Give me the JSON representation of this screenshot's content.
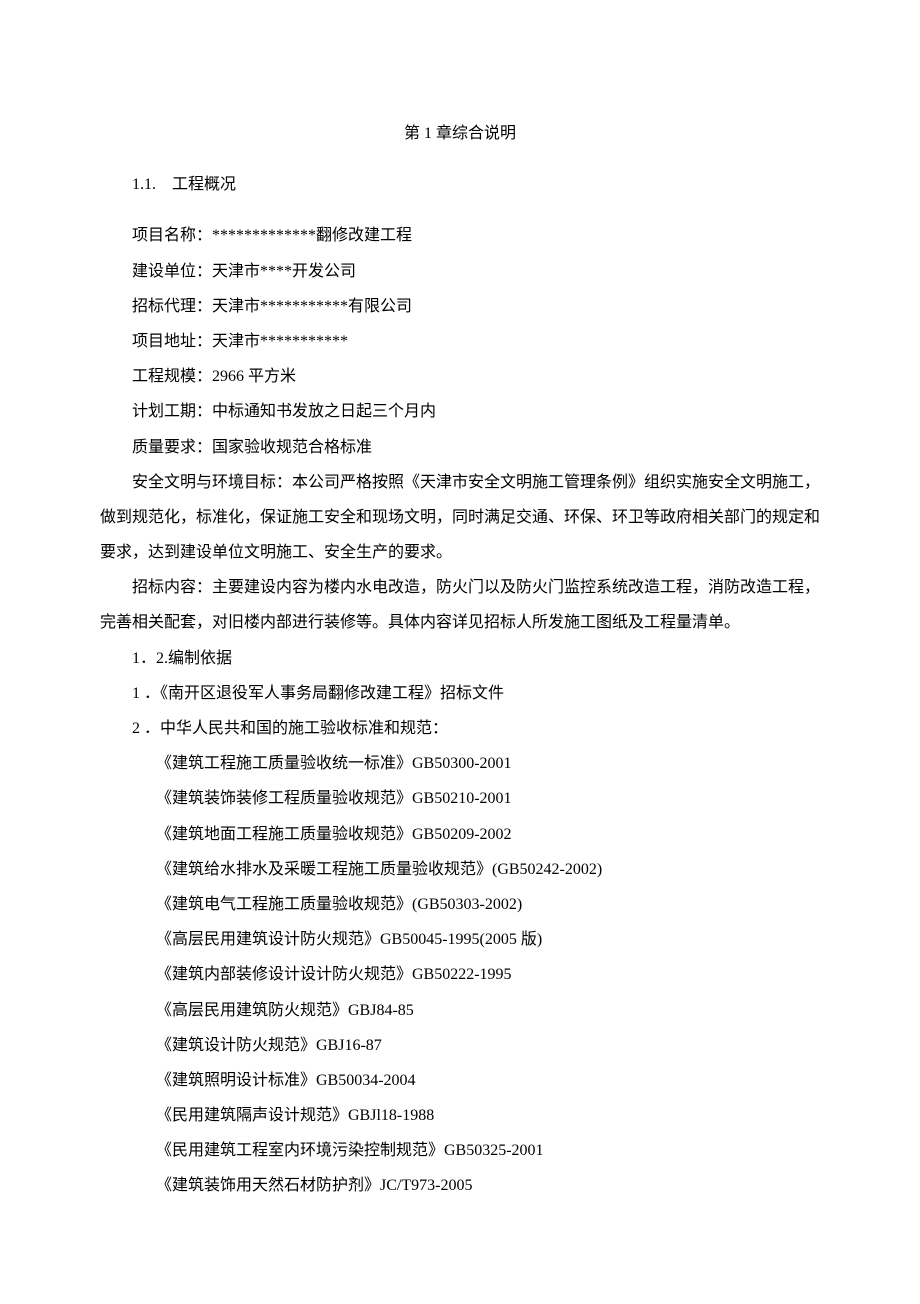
{
  "title": "第 1 章综合说明",
  "s1": {
    "heading": "1.1.　工程概况",
    "project_name": "项目名称：*************翻修改建工程",
    "construction_unit": "建设单位：天津市****开发公司",
    "bidding_agent": "招标代理：天津市***********有限公司",
    "project_address": "项目地址：天津市***********",
    "project_scale": "工程规模：2966 平方米",
    "planned_duration": "计划工期：中标通知书发放之日起三个月内",
    "quality_requirement": "质量要求：国家验收规范合格标准",
    "safety_para": "安全文明与环境目标：本公司严格按照《天津市安全文明施工管理条例》组织实施安全文明施工，做到规范化，标准化，保证施工安全和现场文明，同时满足交通、环保、环卫等政府相关部门的规定和要求，达到建设单位文明施工、安全生产的要求。",
    "bid_content": "招标内容：主要建设内容为楼内水电改造，防火门以及防火门监控系统改造工程，消防改造工程，完善相关配套，对旧楼内部进行装修等。具体内容详见招标人所发施工图纸及工程量清单。"
  },
  "s2": {
    "heading": "1．2.编制依据",
    "item1": "1 ．《南开区退役军人事务局翻修改建工程》招标文件",
    "item2": "2 ．中华人民共和国的施工验收标准和规范：",
    "standards": [
      "《建筑工程施工质量验收统一标准》GB50300-2001",
      "《建筑装饰装修工程质量验收规范》GB50210-2001",
      "《建筑地面工程施工质量验收规范》GB50209-2002",
      "《建筑给水排水及采暖工程施工质量验收规范》(GB50242-2002)",
      "《建筑电气工程施工质量验收规范》(GB50303-2002)",
      "《高层民用建筑设计防火规范》GB50045-1995(2005 版)",
      "《建筑内部装修设计设计防火规范》GB50222-1995",
      "《高层民用建筑防火规范》GBJ84-85",
      "《建筑设计防火规范》GBJ16-87",
      "《建筑照明设计标准》GB50034-2004",
      "《民用建筑隔声设计规范》GBJl18-1988",
      "《民用建筑工程室内环境污染控制规范》GB50325-2001",
      "《建筑装饰用天然石材防护剂》JC/T973-2005"
    ]
  }
}
